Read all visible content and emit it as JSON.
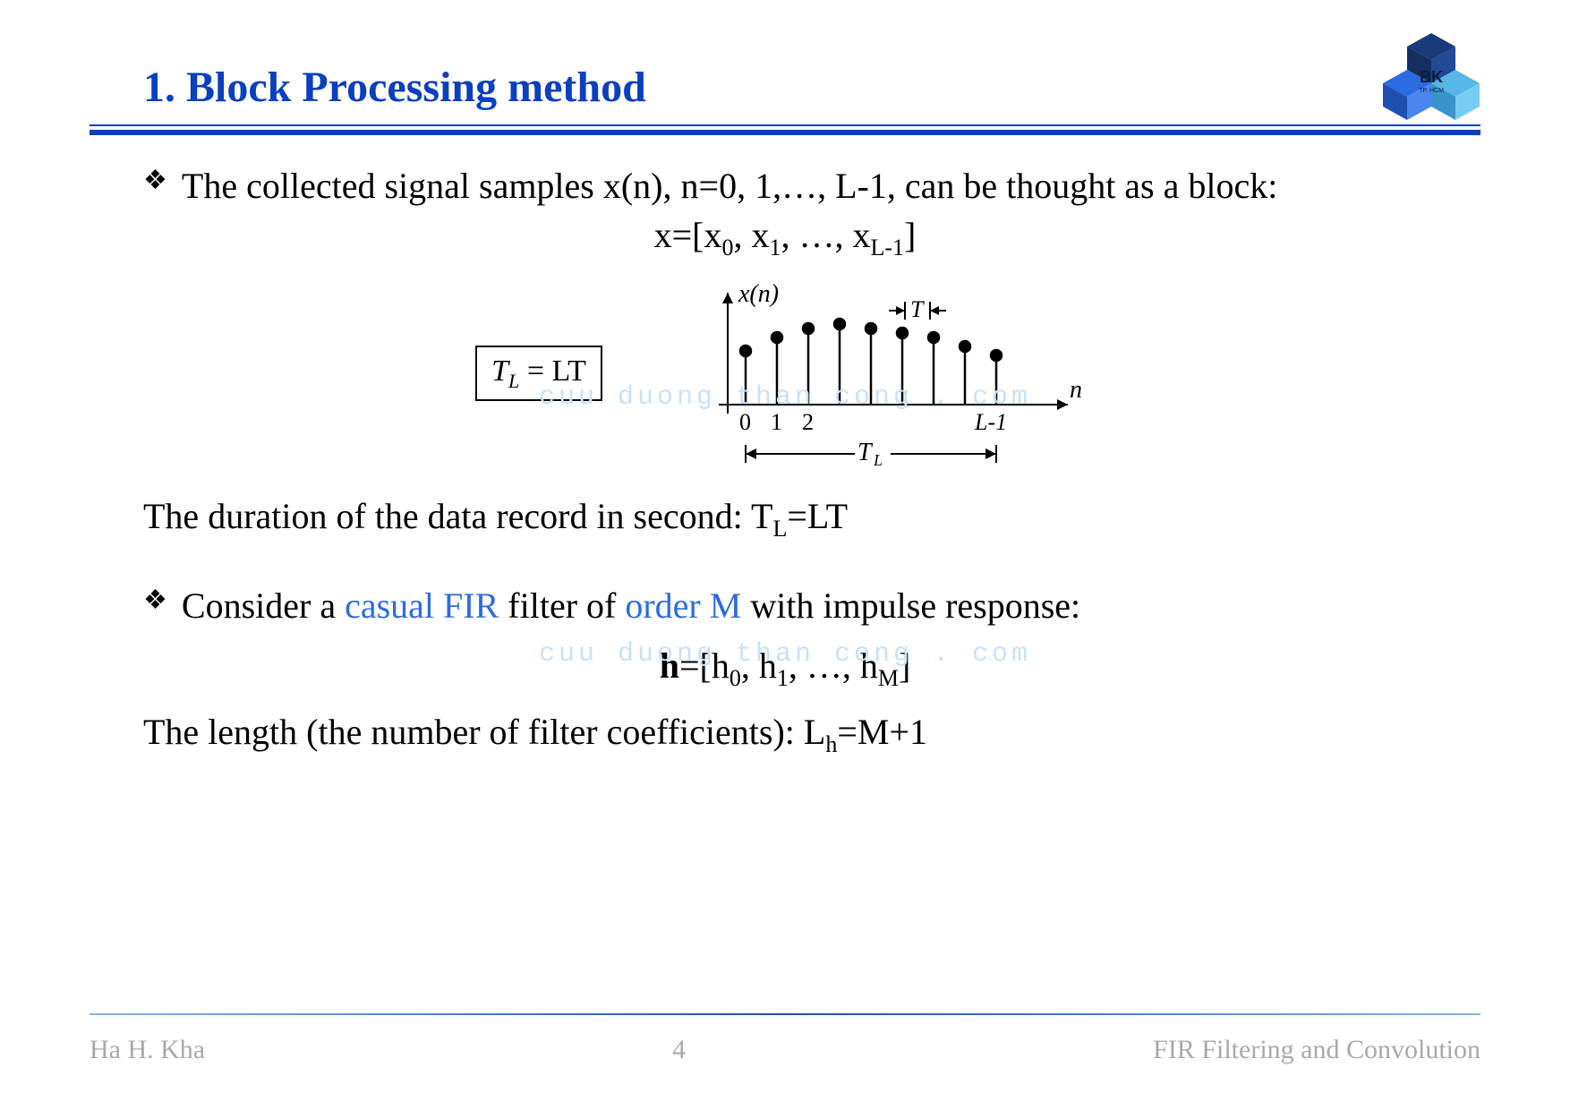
{
  "title": "1. Block Processing method",
  "logo_text_top": "BK",
  "logo_text_bottom": "TP. HCM",
  "bullet1_text": "The collected signal samples x(n), n=0, 1,…, L-1, can be thought as a block:",
  "equation_x": "x=[x",
  "equation_x_parts": {
    "p0": "0",
    "c1": ", x",
    "p1": "1",
    "c2": ", …, x",
    "p2": "L-1",
    "end": "]"
  },
  "formula_box": "T",
  "formula_box_sub": "L",
  "formula_box_rest": "  = LT",
  "diagram": {
    "ylabel": "x(n)",
    "xlabel": "n",
    "t_marker": "T",
    "ticks": [
      "0",
      "1",
      "2"
    ],
    "last_tick": "L-1",
    "span_label": "T",
    "span_label_sub": "L"
  },
  "watermark1": "cuu duong than cong . com",
  "line_duration_a": "The duration of the data record in second: T",
  "line_duration_sub": "L",
  "line_duration_b": "=LT",
  "bullet2_a": "Consider a ",
  "bullet2_b": "casual FIR",
  "bullet2_c": " filter of ",
  "bullet2_d": "order M",
  "bullet2_e": " with impulse response:",
  "watermark2": "cuu duong than cong . com",
  "equation_h_bold": "h",
  "equation_h_parts": {
    "start": "=[h",
    "p0": "0",
    "c1": ", h",
    "p1": "1",
    "c2": ", …, h",
    "p2": "M",
    "end": "]"
  },
  "line_length_a": "The length (the number of filter coefficients): L",
  "line_length_sub": "h",
  "line_length_b": "=M+1",
  "footer": {
    "left": "Ha H. Kha",
    "center": "4",
    "right": "FIR Filtering and Convolution"
  }
}
